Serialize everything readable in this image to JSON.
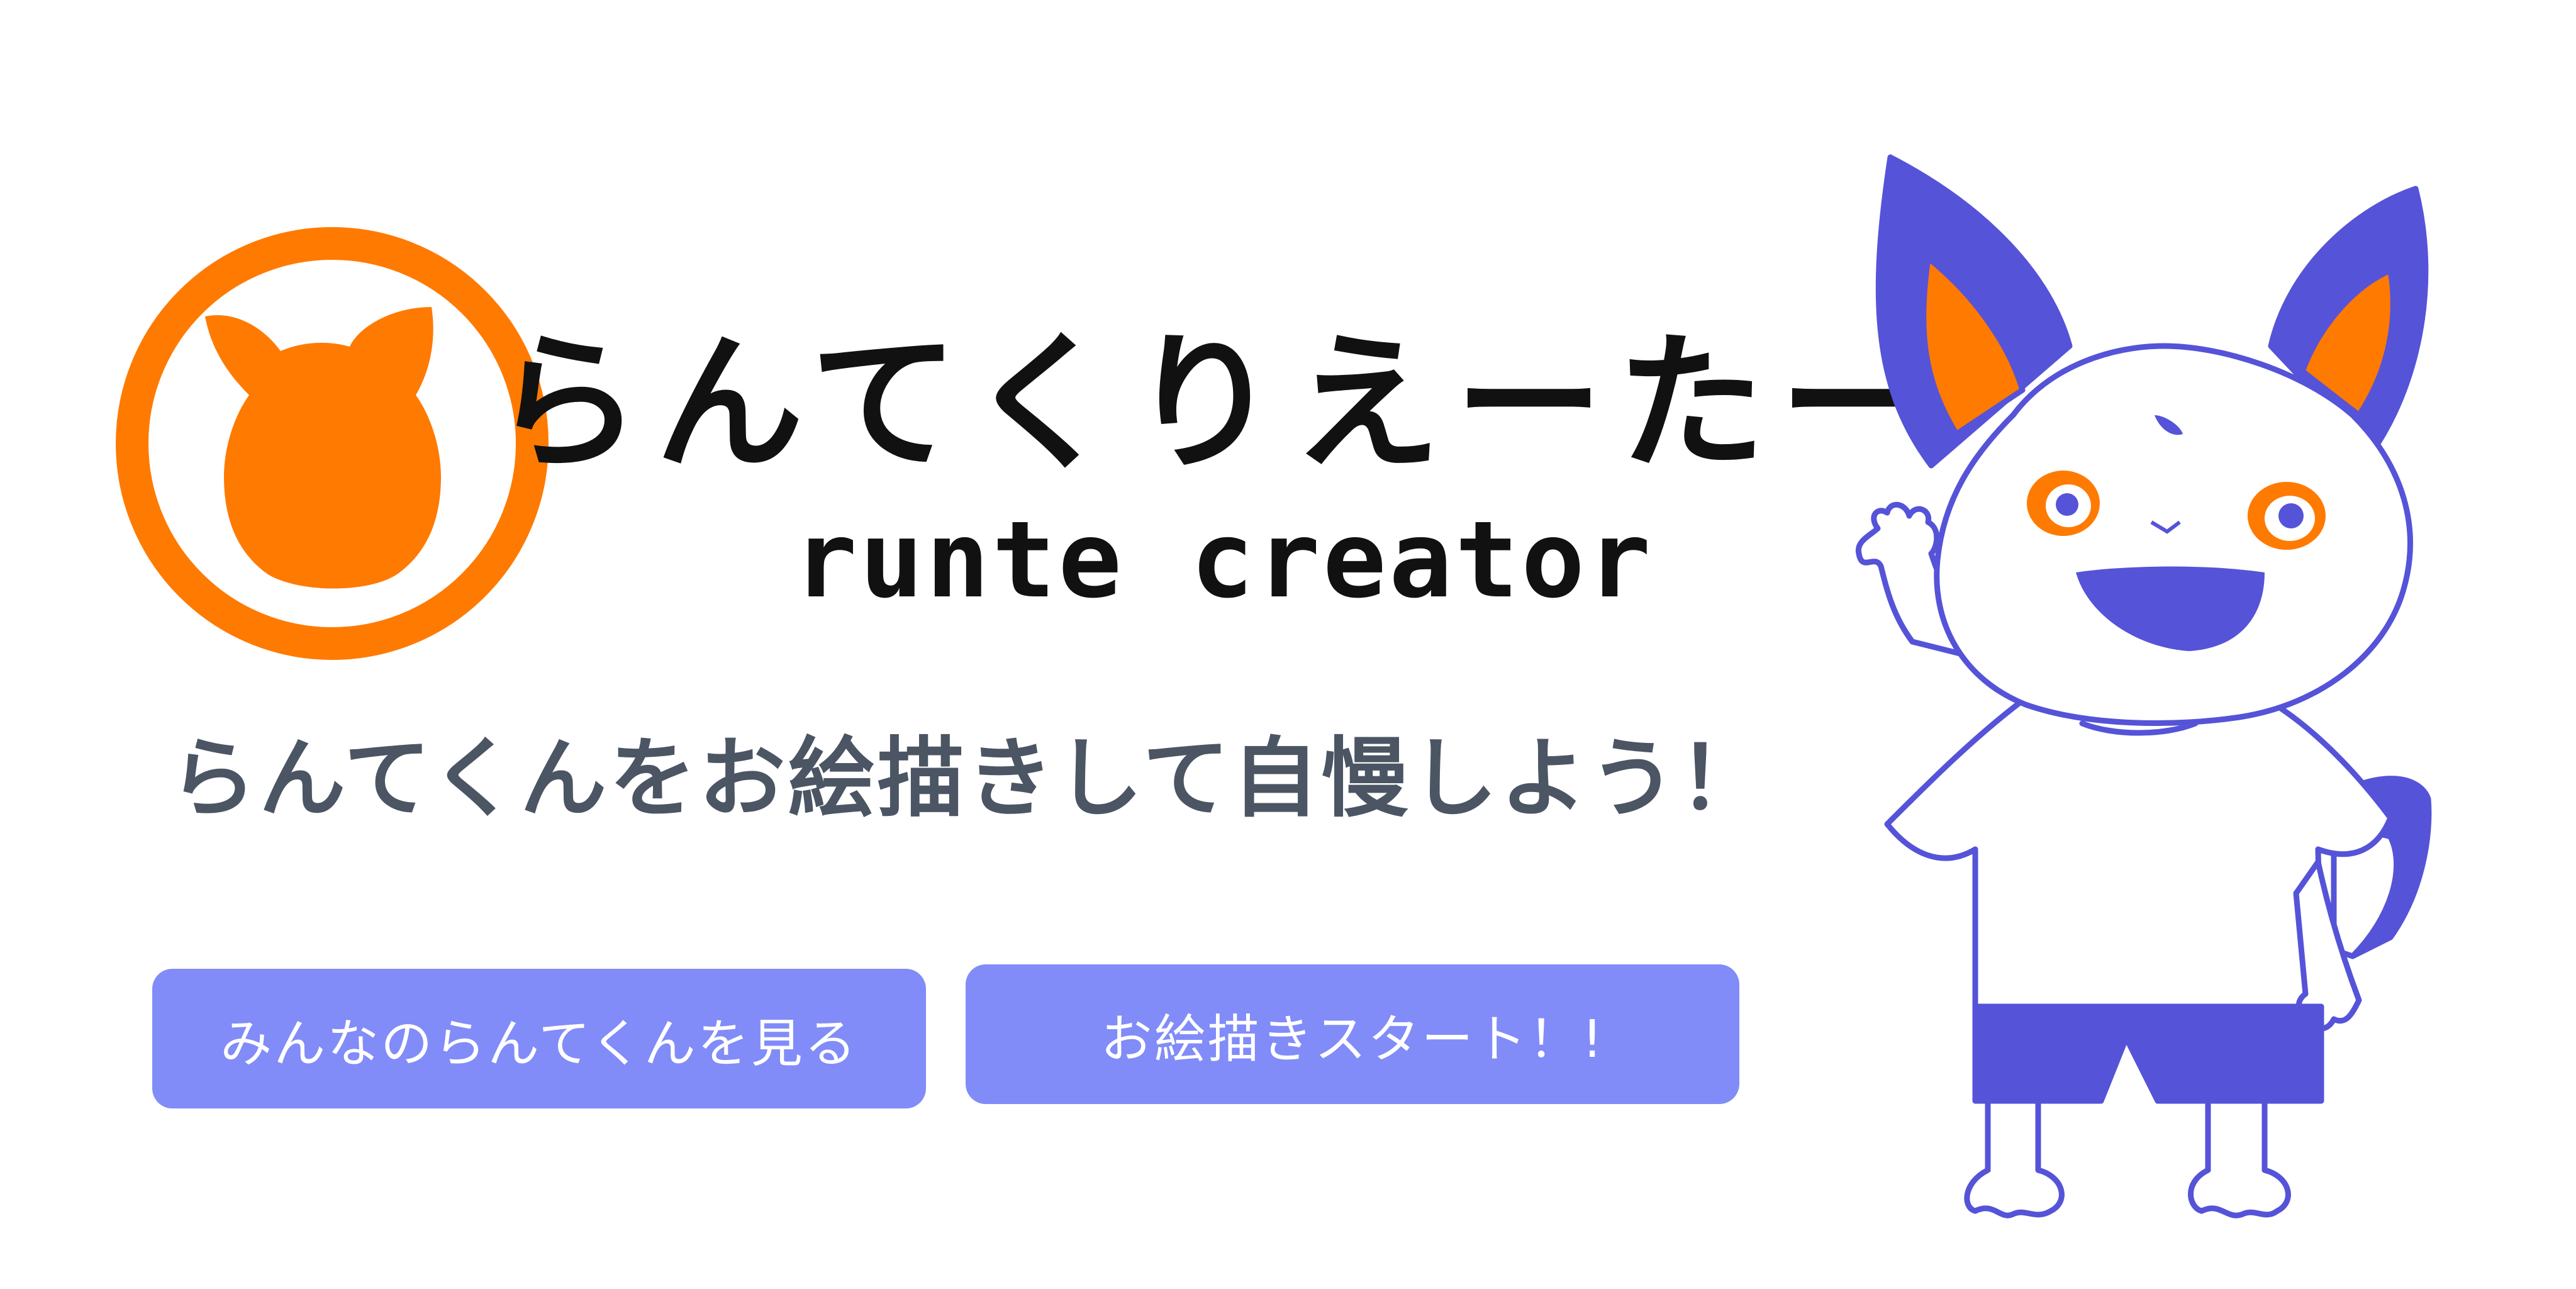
{
  "header": {
    "title_ja": "らんてくりえーたー",
    "title_en": "runte creator"
  },
  "tagline": "らんてくんをお絵描きして自慢しよう！",
  "buttons": {
    "view_all_label": "みんなのらんてくんを見る",
    "start_drawing_label": "お絵描きスタート！!"
  },
  "icons": {
    "logo": "fox-head-emblem-icon",
    "mascot": "runte-mascot-illustration"
  },
  "colors": {
    "brand_orange": "#ff7a00",
    "mascot_purple": "#5553d8",
    "button": "#818cf8",
    "tagline_text": "#4b5563",
    "title_text": "#111111"
  }
}
